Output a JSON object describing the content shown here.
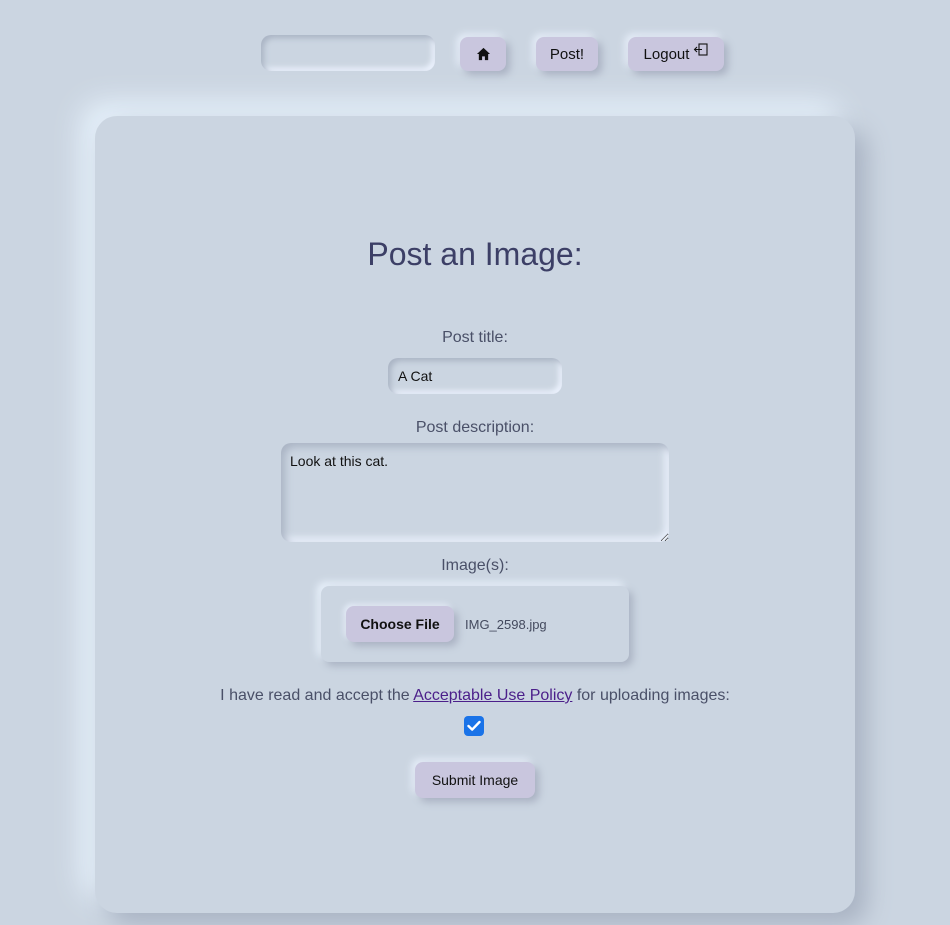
{
  "nav": {
    "search_value": "",
    "home_icon": "home-icon",
    "post_label": "Post!",
    "logout_label": "Logout",
    "logout_icon": "sign-out-icon"
  },
  "form": {
    "title": "Post an Image:",
    "post_title_label": "Post title:",
    "post_title_value": "A Cat",
    "post_description_label": "Post description:",
    "post_description_value": "Look at this cat.",
    "images_label": "Image(s):",
    "choose_file_label": "Choose File",
    "file_name": "IMG_2598.jpg",
    "policy_prefix": "I have read and accept the ",
    "policy_link": "Acceptable Use Policy",
    "policy_suffix": " for uploading images:",
    "policy_accepted": true,
    "submit_label": "Submit Image"
  },
  "colors": {
    "background": "#cbd5e1",
    "button": "#c9c6de",
    "heading": "#3c3f66",
    "link": "#4b1f8a",
    "checkbox": "#1a73e8"
  }
}
